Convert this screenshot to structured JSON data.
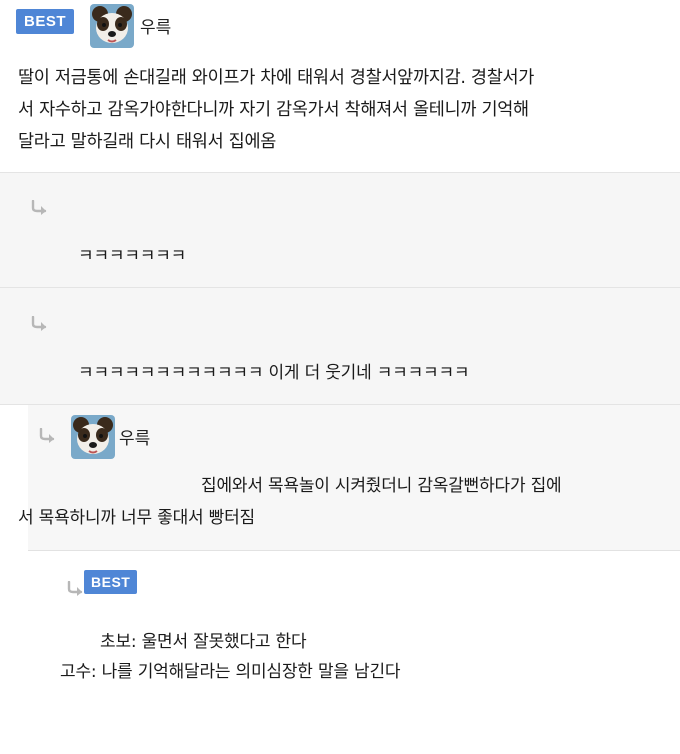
{
  "post": {
    "badge": "BEST",
    "username": "우륵",
    "body_lines": [
      "딸이 저금통에 손대길래 와이프가 차에 태워서 경찰서앞까지감. 경찰서가",
      "서 자수하고 감옥가야한다니까 자기 감옥가서 착해져서 올테니까 기억해",
      "달라고 말하길래 다시 태워서 집에옴"
    ]
  },
  "replies": [
    {
      "text": "ㅋㅋㅋㅋㅋㅋㅋ"
    },
    {
      "text": "ㅋㅋㅋㅋㅋㅋㅋㅋㅋㅋㅋㅋ 이게 더 웃기네 ㅋㅋㅋㅋㅋㅋ"
    }
  ],
  "nested_reply": {
    "username": "우륵",
    "lines": [
      "집에와서 목욕놀이 시켜줬더니 감옥갈뻔하다가 집에",
      "서 목욕하니까 너무 좋대서 빵터짐"
    ]
  },
  "best_reply": {
    "badge": "BEST",
    "lines": [
      "초보: 울면서 잘못했다고 한다",
      "고수: 나를 기억해달라는 의미심장한 말을 남긴다"
    ]
  },
  "colors": {
    "badge": "#4f86d6",
    "reply_bg": "#f6f6f6",
    "arrow": "#b7b7b7"
  },
  "icons": {
    "reply": "reply-arrow-icon",
    "avatar": "dog-avatar"
  }
}
